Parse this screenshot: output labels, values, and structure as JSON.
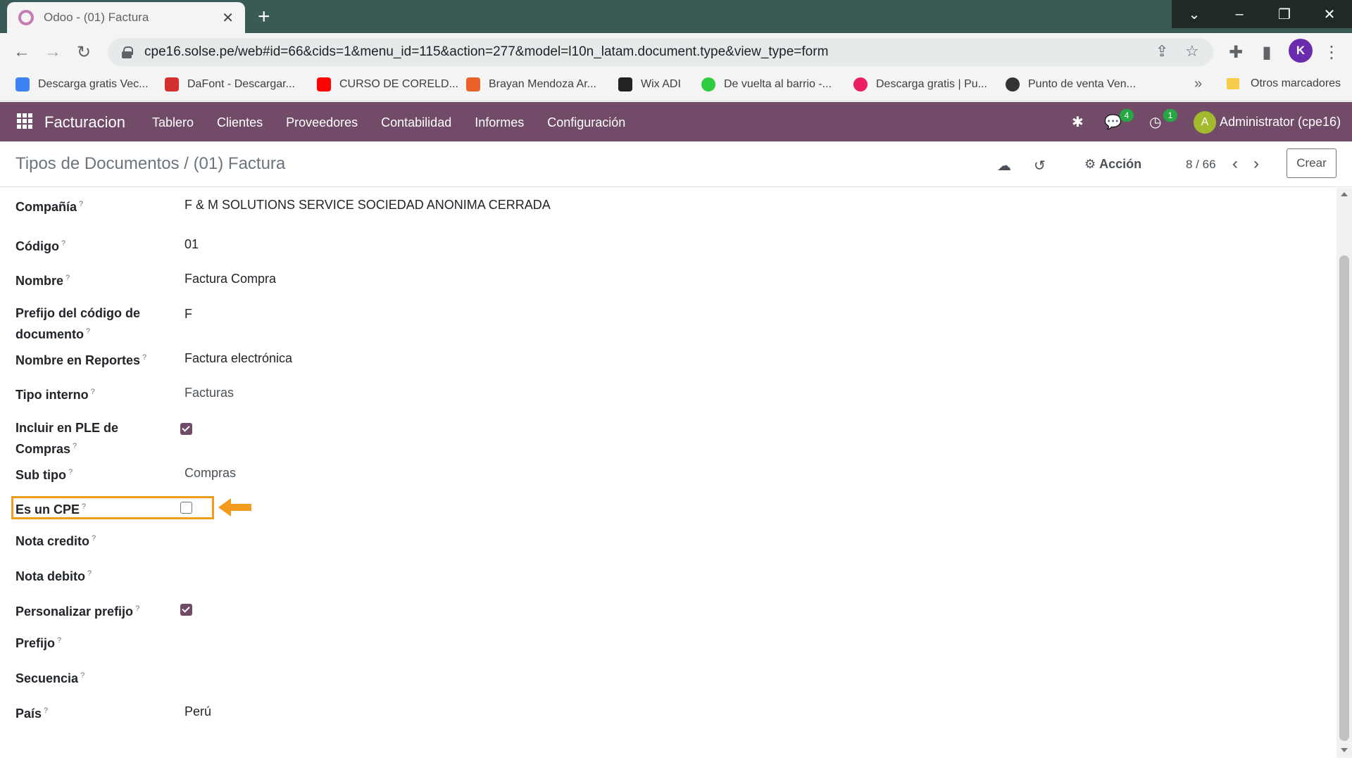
{
  "browser": {
    "tab_title": "Odoo - (01) Factura",
    "url": "cpe16.solse.pe/web#id=66&cids=1&menu_id=115&action=277&model=l10n_latam.document.type&view_type=form",
    "profile_initial": "K",
    "bookmarks": [
      {
        "label": "Descarga gratis Vec...",
        "color": "#3b82f6"
      },
      {
        "label": "DaFont - Descargar...",
        "color": "#d32f2f"
      },
      {
        "label": "CURSO DE CORELD...",
        "color": "#ff0000"
      },
      {
        "label": "Brayan Mendoza Ar...",
        "color": "#e8622c"
      },
      {
        "label": "Wix ADI",
        "color": "#222222"
      },
      {
        "label": "De vuelta al barrio -...",
        "color": "#2ecc40"
      },
      {
        "label": "Descarga gratis | Pu...",
        "color": "#e91e63"
      },
      {
        "label": "Punto de venta Ven...",
        "color": "#333333"
      }
    ],
    "other_bookmarks": "Otros marcadores"
  },
  "navbar": {
    "app_name": "Facturacion",
    "menu": [
      "Tablero",
      "Clientes",
      "Proveedores",
      "Contabilidad",
      "Informes",
      "Configuración"
    ],
    "messages_badge": "4",
    "activities_badge": "1",
    "user_initial": "A",
    "user_name": "Administrator (cpe16)",
    "accent_color": "#714b67"
  },
  "control_panel": {
    "breadcrumb": "Tipos de Documentos / (01) Factura",
    "action_label": "Acción",
    "pager": "8 / 66",
    "create_label": "Crear"
  },
  "form": {
    "fields": [
      {
        "label": "Compañía",
        "help": "?",
        "value": "F & M SOLUTIONS SERVICE SOCIEDAD ANONIMA CERRADA"
      },
      {
        "label": "Código",
        "help": "?",
        "value": "01"
      },
      {
        "label": "Nombre",
        "help": "?",
        "value": "Factura Compra"
      },
      {
        "label": "Prefijo del código de documento",
        "help": "?",
        "value": "F"
      },
      {
        "label": "Nombre en Reportes",
        "help": "?",
        "value": "Factura electrónica"
      },
      {
        "label": "Tipo interno",
        "help": "?",
        "value": "Facturas"
      },
      {
        "label": "Incluir en PLE de Compras",
        "help": "?",
        "checked": true
      },
      {
        "label": "Sub tipo",
        "help": "?",
        "value": "Compras"
      },
      {
        "label": "Es un CPE",
        "help": "?",
        "checked": false
      },
      {
        "label": "Nota credito",
        "help": "?",
        "value": ""
      },
      {
        "label": "Nota debito",
        "help": "?",
        "value": ""
      },
      {
        "label": "Personalizar prefijo",
        "help": "?",
        "checked": true
      },
      {
        "label": "Prefijo",
        "help": "?",
        "value": ""
      },
      {
        "label": "Secuencia",
        "help": "?",
        "value": ""
      },
      {
        "label": "País",
        "help": "?",
        "value": "Perú"
      }
    ]
  },
  "annotation_color": "#f29b1d"
}
